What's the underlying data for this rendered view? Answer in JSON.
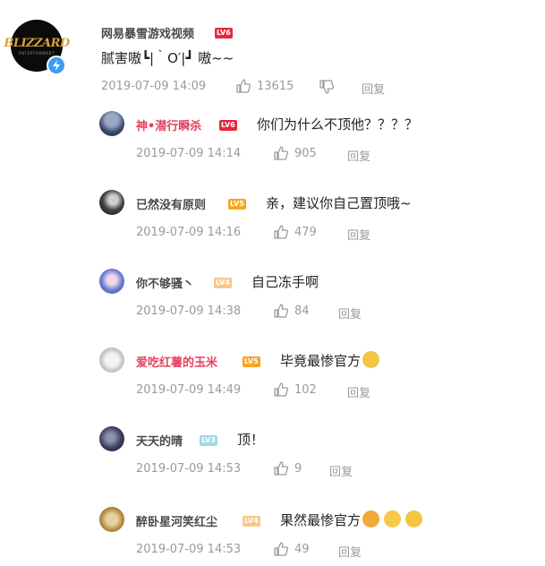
{
  "main_comment": {
    "author": "网易暴雪游戏视频",
    "level": "LV6",
    "avatar_logo": "BLIZZARD",
    "avatar_logo_sub": "ENTERTAINMENT",
    "text": "腻害嗷┗|｀O′|┛ 嗷~~",
    "timestamp": "2019-07-09 14:09",
    "likes": "13615",
    "reply_label": "回复"
  },
  "replies": [
    {
      "author": "神•潜行瞬杀",
      "level": "LV6",
      "text": "你们为什么不顶他？？？？",
      "timestamp": "2019-07-09 14:14",
      "likes": "905",
      "reply_label": "回复"
    },
    {
      "author": "已然没有原则",
      "level": "LV5",
      "text": "亲，建议你自己置顶哦~",
      "timestamp": "2019-07-09 14:16",
      "likes": "479",
      "reply_label": "回复"
    },
    {
      "author": "你不够骚丶",
      "level": "LV4",
      "text": "自己冻手啊",
      "timestamp": "2019-07-09 14:38",
      "likes": "84",
      "reply_label": "回复"
    },
    {
      "author": "爱吃红薯的玉米",
      "level": "LV5",
      "text": "毕竟最惨官方",
      "timestamp": "2019-07-09 14:49",
      "likes": "102",
      "reply_label": "回复"
    },
    {
      "author": "天天的晴",
      "level": "LV3",
      "text": "顶！",
      "timestamp": "2019-07-09 14:53",
      "likes": "9",
      "reply_label": "回复"
    },
    {
      "author": "醉卧星河笑红尘",
      "level": "LV4",
      "text": "果然最惨官方",
      "timestamp": "2019-07-09 14:53",
      "likes": "49",
      "reply_label": "回复"
    }
  ],
  "colors": {
    "name_pink": "#e8405f",
    "name_gray": "#4a4a4a",
    "meta_gray": "#9a9a9a",
    "verify_blue": "#3b9cf5"
  },
  "icons": [
    "like-icon",
    "dislike-icon",
    "verified-icon",
    "emoji-doge-icon",
    "emoji-angry-icon",
    "emoji-grin-icon"
  ]
}
